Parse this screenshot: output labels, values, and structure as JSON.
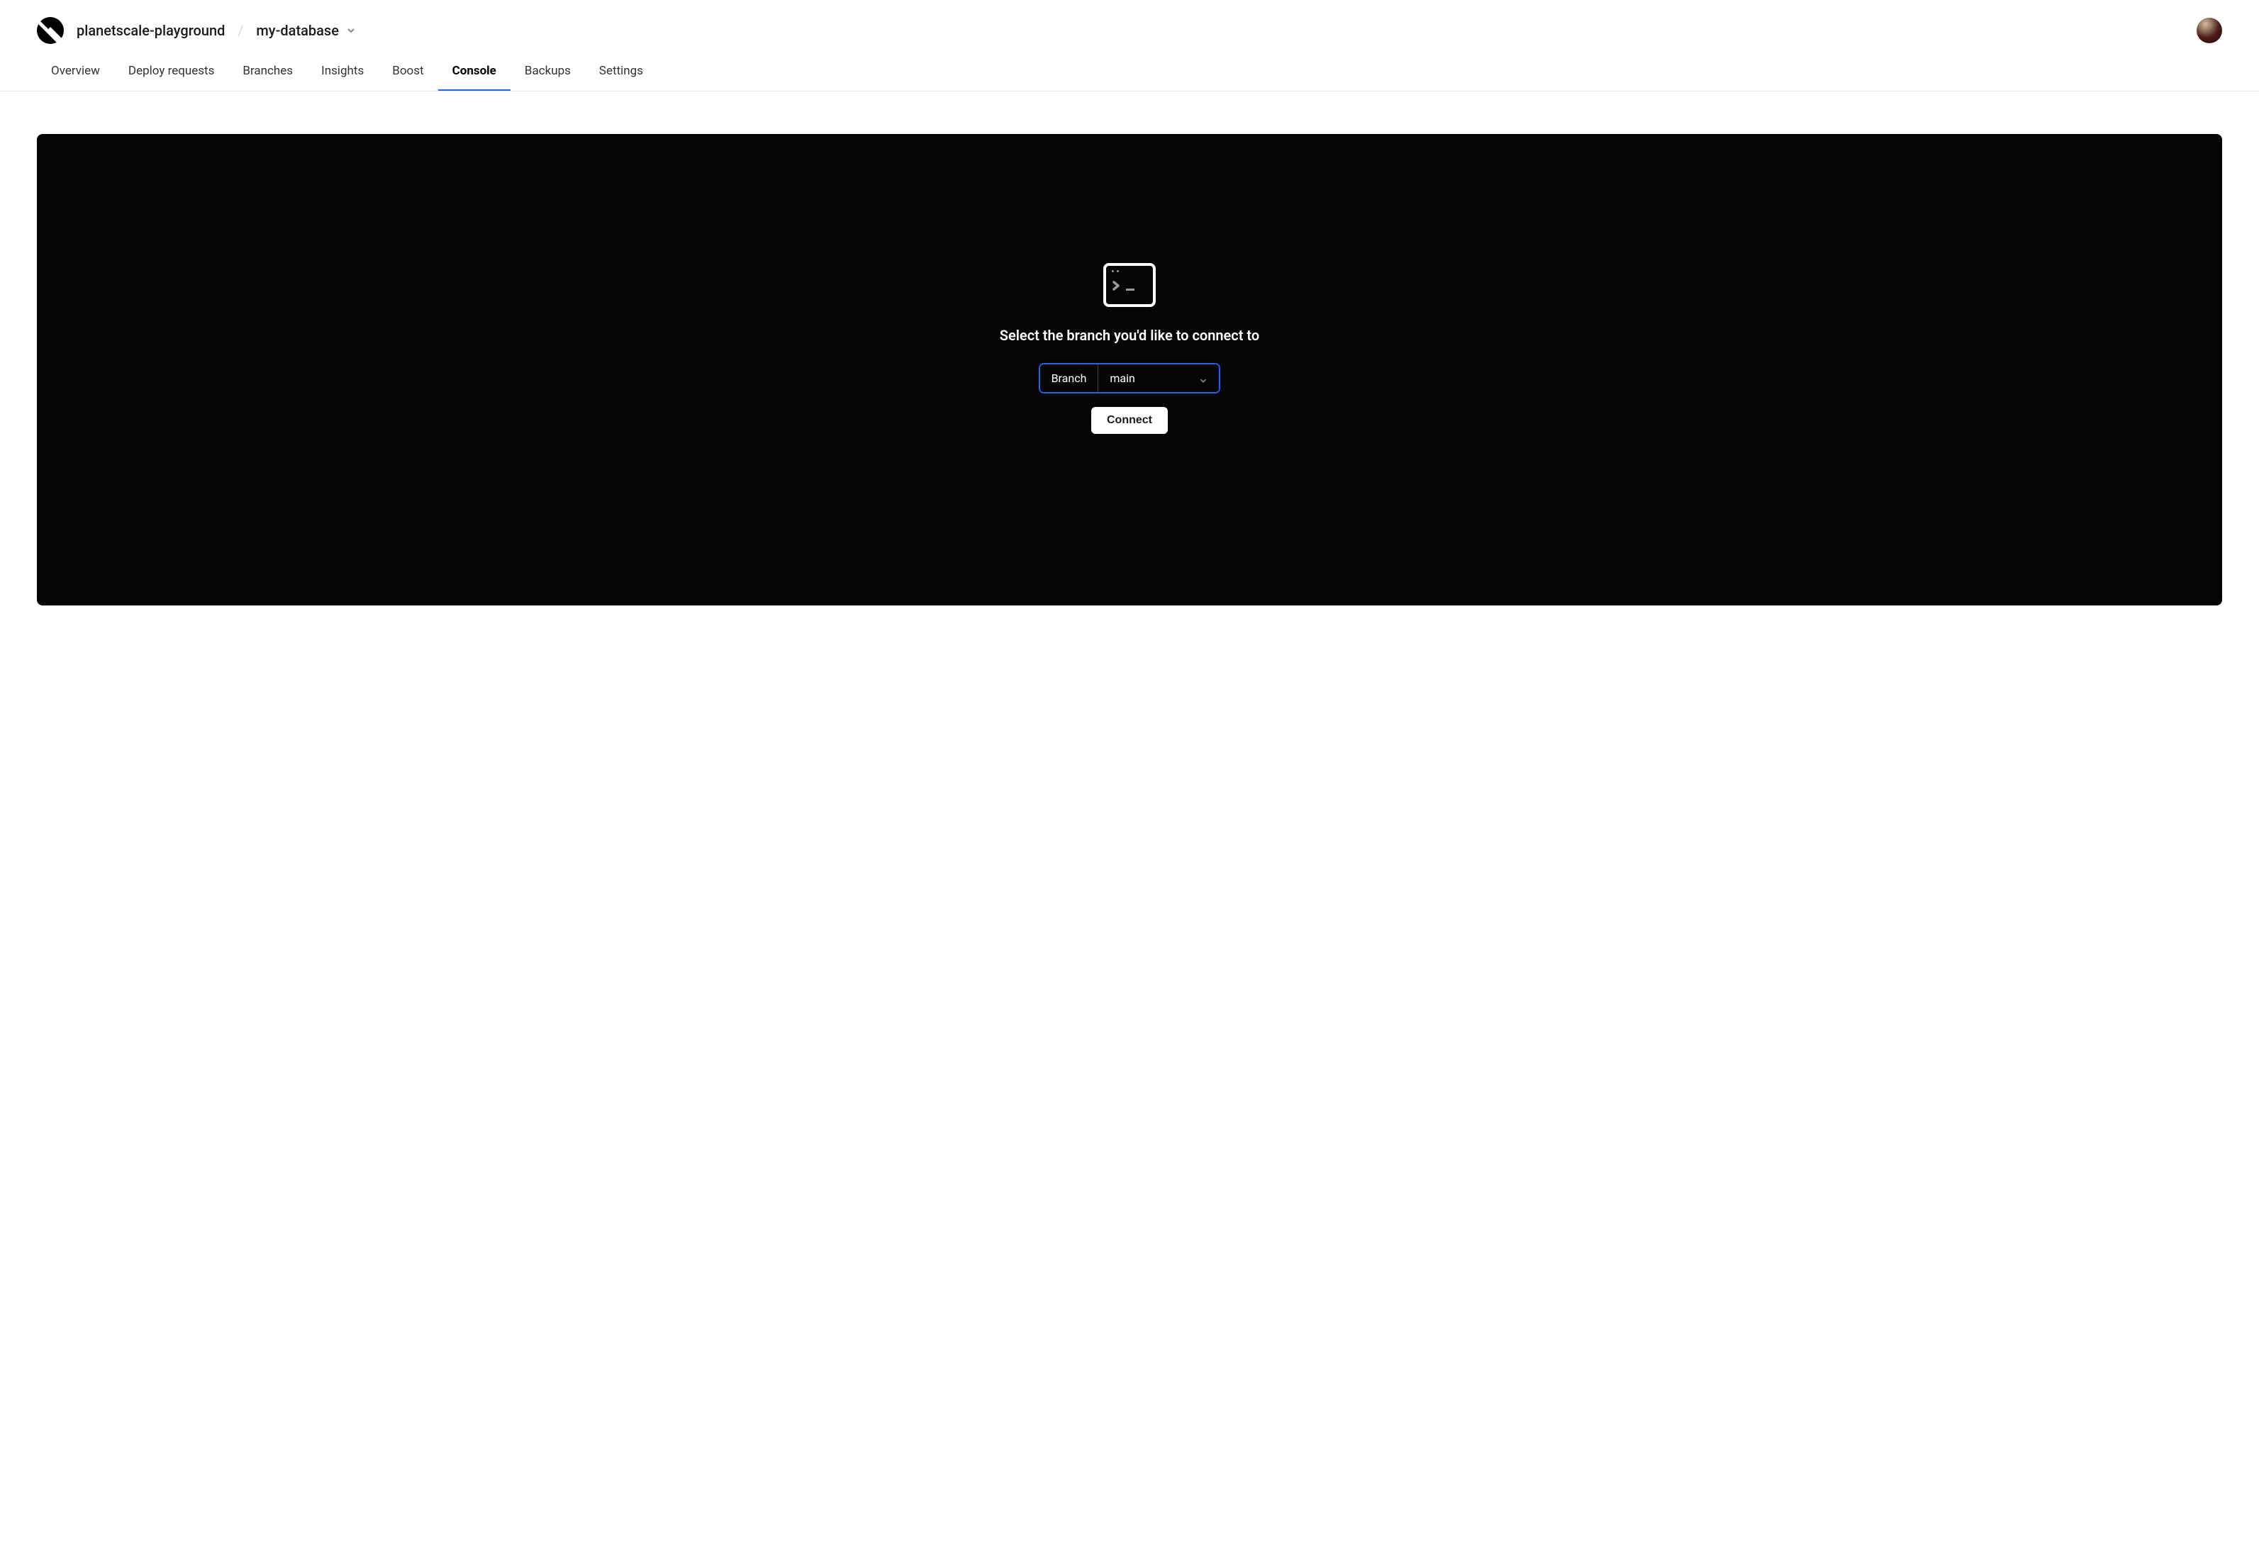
{
  "header": {
    "org_name": "planetscale-playground",
    "db_name": "my-database"
  },
  "tabs": [
    {
      "label": "Overview",
      "active": false
    },
    {
      "label": "Deploy requests",
      "active": false
    },
    {
      "label": "Branches",
      "active": false
    },
    {
      "label": "Insights",
      "active": false
    },
    {
      "label": "Boost",
      "active": false
    },
    {
      "label": "Console",
      "active": true
    },
    {
      "label": "Backups",
      "active": false
    },
    {
      "label": "Settings",
      "active": false
    }
  ],
  "console": {
    "prompt_text": "Select the branch you'd like to connect to",
    "branch_label": "Branch",
    "branch_selected": "main",
    "connect_label": "Connect"
  }
}
